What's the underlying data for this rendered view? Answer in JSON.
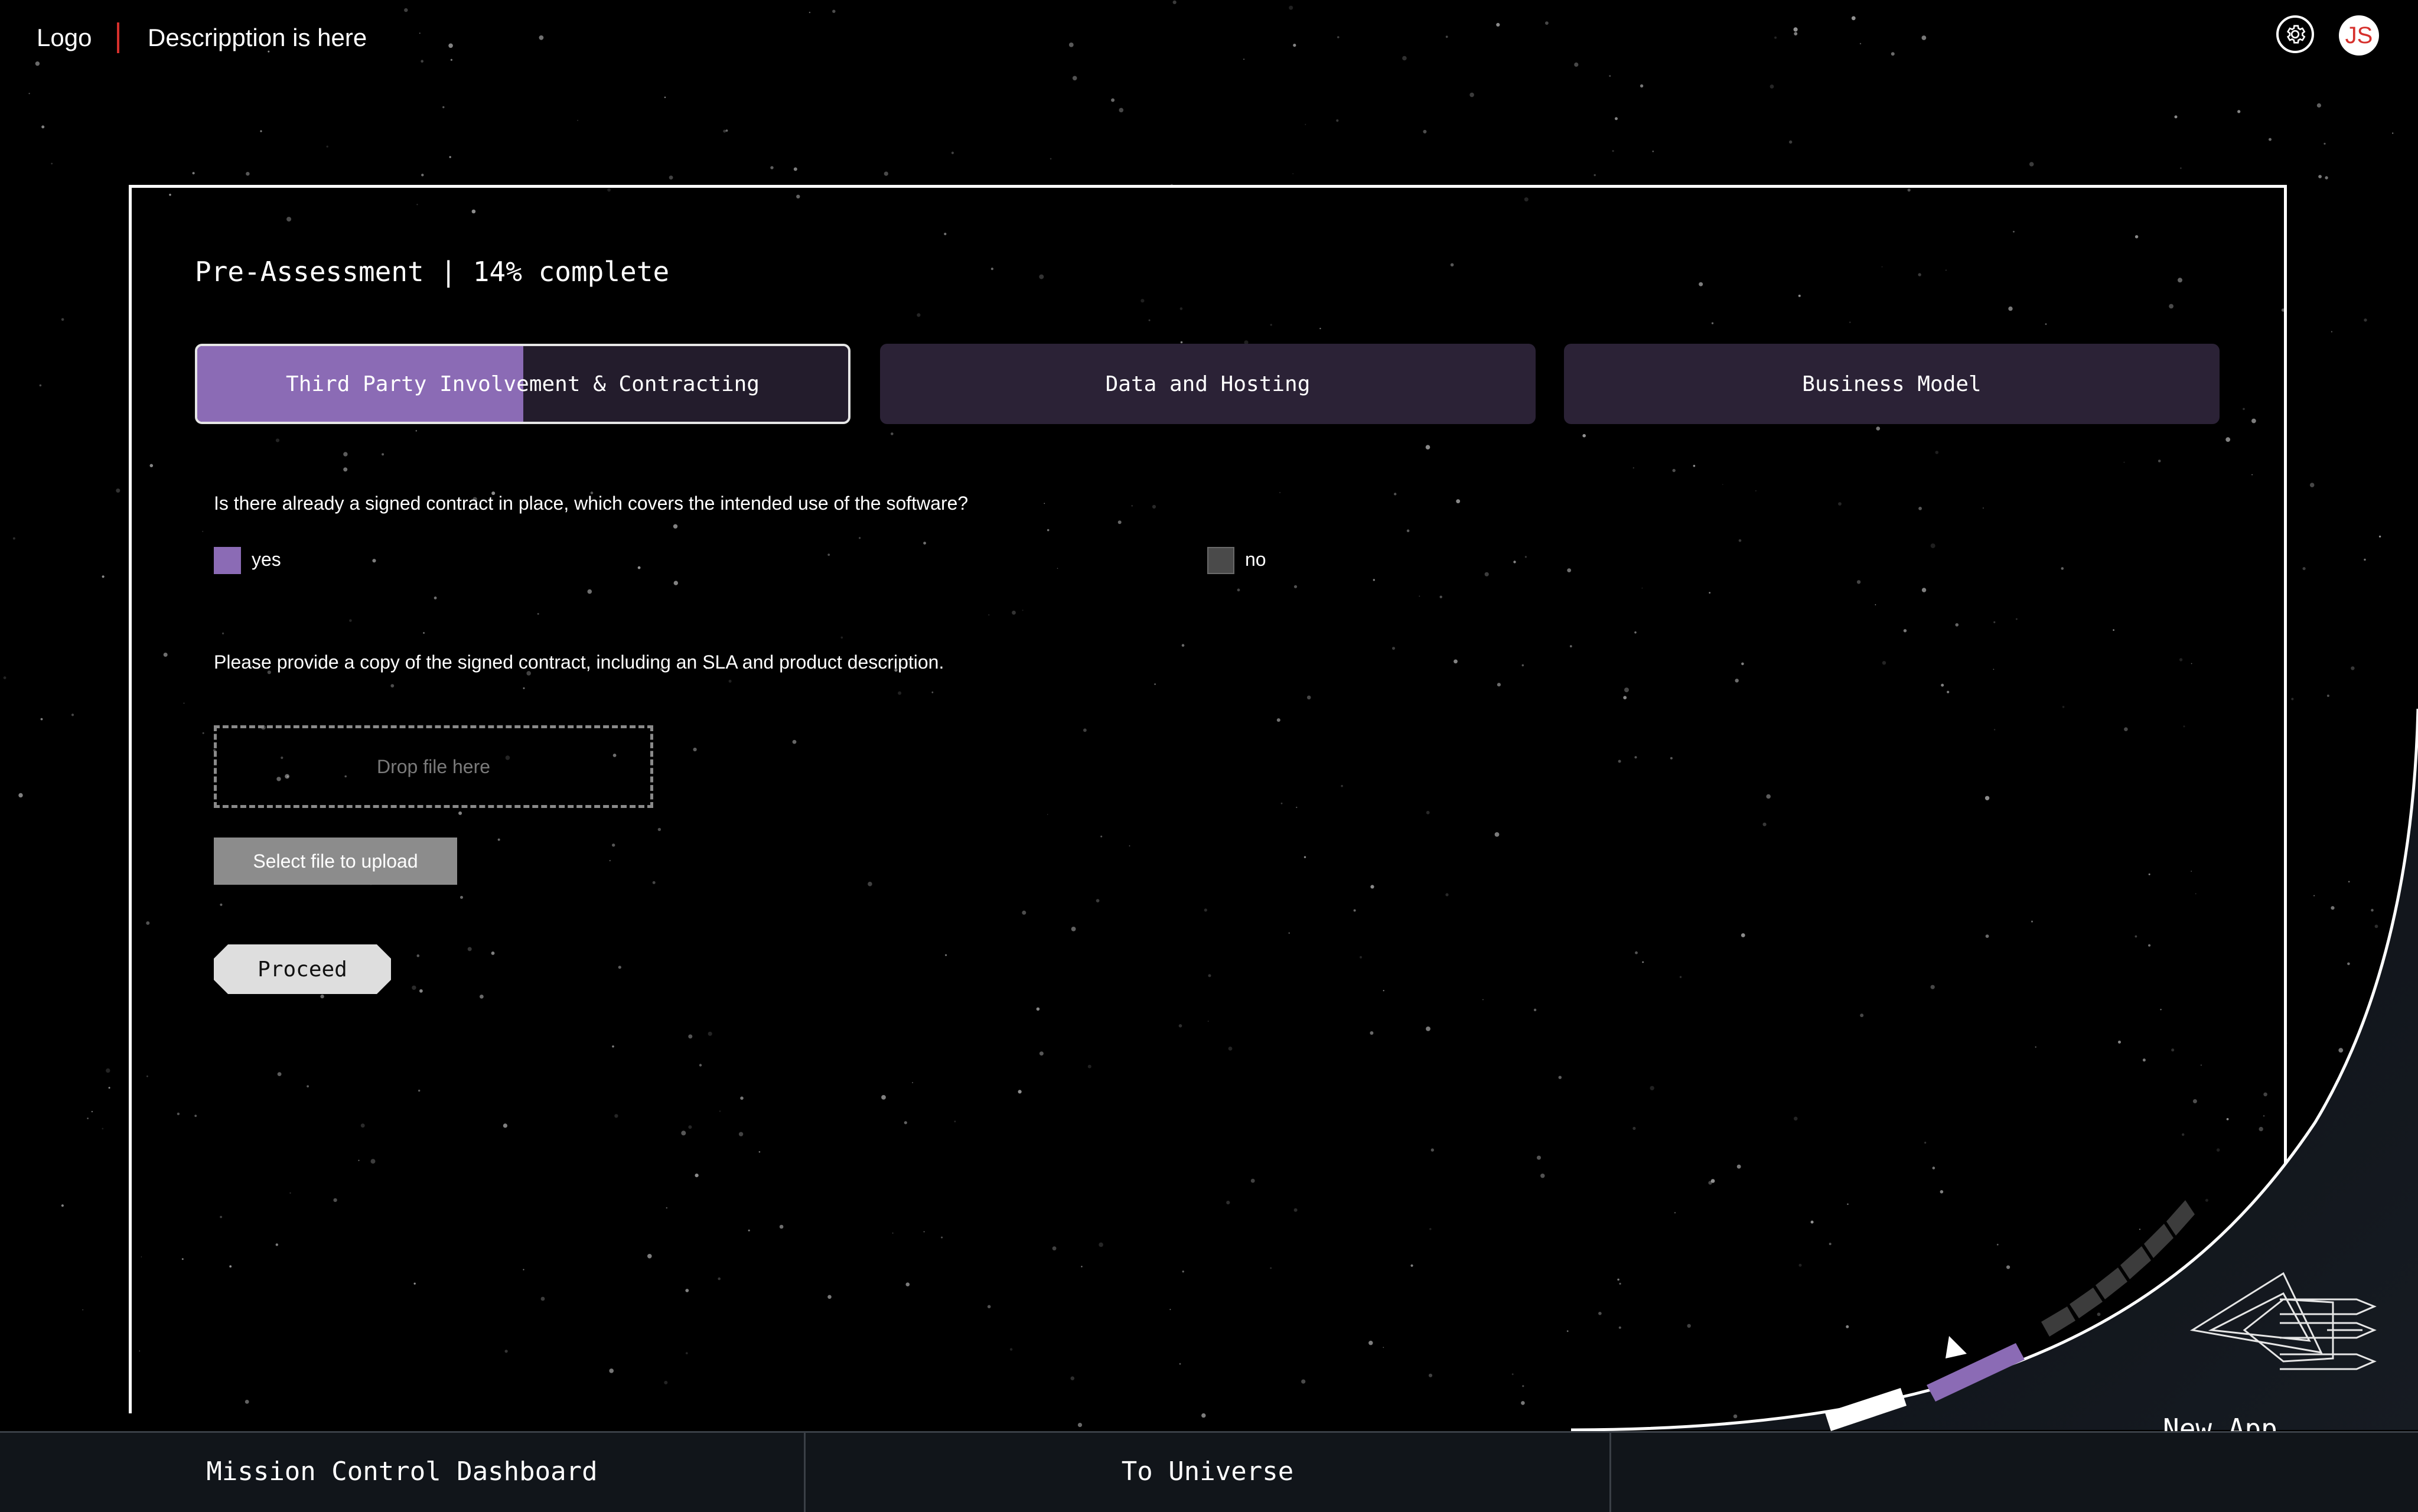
{
  "header": {
    "logo": "Logo",
    "description": "Descripption is here",
    "settings_icon": "gear-icon",
    "avatar_initials": "JS"
  },
  "assessment": {
    "title": "Pre-Assessment | 14% complete",
    "progress_percent": 14,
    "tabs": [
      {
        "label": "Third Party Involvement & Contracting",
        "active": true,
        "progress": 0.5
      },
      {
        "label": "Data and Hosting",
        "active": false
      },
      {
        "label": "Business Model",
        "active": false
      }
    ],
    "question1": {
      "text": "Is there already a signed contract in place, which covers the intended use of the software?",
      "options": [
        {
          "label": "yes",
          "selected": true
        },
        {
          "label": "no",
          "selected": false
        }
      ]
    },
    "question2": {
      "text": "Please provide a copy of the signed contract, including an SLA and product description."
    },
    "dropzone_text": "Drop file here",
    "select_file_label": "Select file to upload",
    "proceed_label": "Proceed"
  },
  "bottom_nav": {
    "items": [
      "Mission Control Dashboard",
      "To Universe"
    ]
  },
  "new_app_label": "New App",
  "colors": {
    "accent": "#8b6bb5",
    "brand_red": "#d6302c",
    "tab_bg": "#2b2236",
    "bottom_bar": "#11151a"
  }
}
